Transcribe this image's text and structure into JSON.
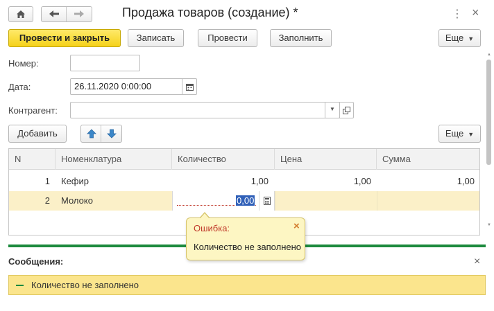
{
  "window": {
    "title": "Продажа товаров (создание) *",
    "more_icon": "vertical-ellipsis-icon",
    "close_icon": "close-icon"
  },
  "nav": {
    "home_icon": "home-icon",
    "back_icon": "arrow-left-icon",
    "forward_icon": "arrow-right-icon"
  },
  "toolbar": {
    "post_and_close": "Провести и закрыть",
    "write": "Записать",
    "post": "Провести",
    "fill": "Заполнить",
    "more": "Еще"
  },
  "form": {
    "number_label": "Номер:",
    "number_value": "",
    "date_label": "Дата:",
    "date_value": "26.11.2020  0:00:00",
    "counterparty_label": "Контрагент:",
    "counterparty_value": ""
  },
  "table_toolbar": {
    "add": "Добавить",
    "move_up_icon": "arrow-up-icon",
    "move_down_icon": "arrow-down-icon",
    "more": "Еще"
  },
  "table": {
    "columns": [
      "N",
      "Номенклатура",
      "Количество",
      "Цена",
      "Сумма"
    ],
    "rows": [
      {
        "n": "1",
        "item": "Кефир",
        "qty": "1,00",
        "price": "1,00",
        "sum": "1,00"
      },
      {
        "n": "2",
        "item": "Молоко",
        "qty": "0,00",
        "price": "",
        "sum": ""
      }
    ]
  },
  "tooltip": {
    "title": "Ошибка:",
    "text": "Количество не заполнено"
  },
  "messages": {
    "title": "Сообщения:",
    "items": [
      "Количество не заполнено"
    ]
  },
  "colors": {
    "primary_button": "#f5d21a",
    "accent_green": "#1c8a3e",
    "selected_row": "#fbf0c8",
    "message_bar": "#fbe58d",
    "tooltip_bg": "#fdf6c3",
    "error_title": "#c0392b",
    "arrow_blue": "#3a86c8"
  }
}
